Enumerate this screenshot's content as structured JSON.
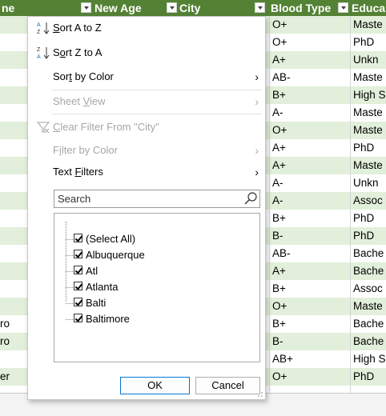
{
  "header": {
    "col_name_fragment": "ne",
    "new_age": "New Age",
    "city": "City",
    "blood_type": "Blood Type",
    "education_fragment": "Educa",
    "fill": "#548235"
  },
  "rows": [
    {
      "c1": "",
      "blood": "O+",
      "edu": "Maste"
    },
    {
      "c1": "",
      "blood": "O+",
      "edu": "PhD"
    },
    {
      "c1": "",
      "blood": "A+",
      "edu": "Unkn"
    },
    {
      "c1": "",
      "blood": "AB-",
      "edu": "Maste"
    },
    {
      "c1": "",
      "blood": "B+",
      "edu": "High S"
    },
    {
      "c1": "",
      "blood": "A-",
      "edu": "Maste"
    },
    {
      "c1": "",
      "blood": "O+",
      "edu": "Maste"
    },
    {
      "c1": "",
      "blood": "A+",
      "edu": "PhD"
    },
    {
      "c1": "",
      "blood": "A+",
      "edu": "Maste"
    },
    {
      "c1": "",
      "blood": "A-",
      "edu": "Unkn"
    },
    {
      "c1": "",
      "blood": "A-",
      "edu": "Assoc"
    },
    {
      "c1": "",
      "blood": "B+",
      "edu": "PhD"
    },
    {
      "c1": "",
      "blood": "B-",
      "edu": "PhD"
    },
    {
      "c1": "",
      "blood": "AB-",
      "edu": "Bache"
    },
    {
      "c1": "",
      "blood": "A+",
      "edu": "Bache"
    },
    {
      "c1": "",
      "blood": "B+",
      "edu": "Assoc"
    },
    {
      "c1": "",
      "blood": "O+",
      "edu": "Maste"
    },
    {
      "c1": "ro",
      "blood": "B+",
      "edu": "Bache"
    },
    {
      "c1": "ro",
      "blood": "B-",
      "edu": "Bache"
    },
    {
      "c1": "",
      "blood": "AB+",
      "edu": "High S"
    },
    {
      "c1": "er",
      "blood": "O+",
      "edu": "PhD"
    }
  ],
  "band_color": "#e2efda",
  "menu": {
    "sort_az": {
      "pre": "",
      "u": "S",
      "post": "ort A to Z"
    },
    "sort_za": {
      "pre": "S",
      "u": "o",
      "post": "rt Z to A"
    },
    "sort_by_color": {
      "pre": "Sor",
      "u": "t",
      "post": " by Color"
    },
    "sheet_view": {
      "pre": "Sheet ",
      "u": "V",
      "post": "iew"
    },
    "clear_filter": {
      "pre": "",
      "u": "C",
      "post": "lear Filter From \"City\""
    },
    "filter_by_color": {
      "pre": "F",
      "u": "i",
      "post": "lter by Color"
    },
    "text_filters": {
      "pre": "Text ",
      "u": "F",
      "post": "ilters"
    },
    "search_placeholder": "Search",
    "items": [
      {
        "label": "(Select All)",
        "checked": true
      },
      {
        "label": "Albuquerque",
        "checked": true
      },
      {
        "label": "Atl",
        "checked": true
      },
      {
        "label": "Atlanta",
        "checked": true
      },
      {
        "label": "Balti",
        "checked": true
      },
      {
        "label": "Baltimore",
        "checked": true
      }
    ],
    "ok": "OK",
    "cancel": "Cancel"
  },
  "icons": {
    "sort_az": "sort-ascending-icon",
    "sort_za": "sort-descending-icon",
    "clear": "clear-filter-icon",
    "search": "search-icon"
  }
}
